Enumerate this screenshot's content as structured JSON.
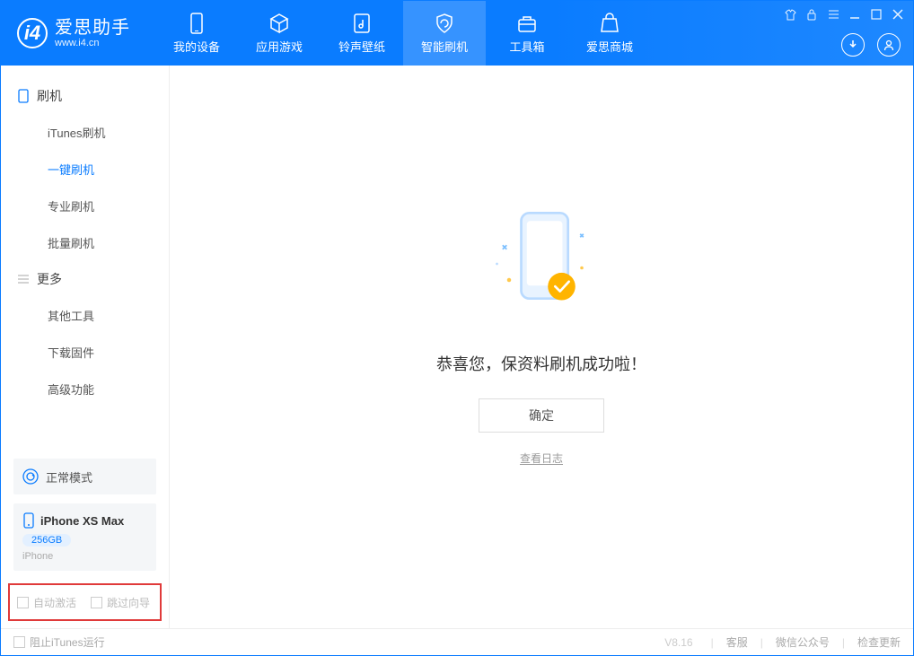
{
  "app": {
    "title": "爱思助手",
    "url": "www.i4.cn"
  },
  "nav": {
    "tabs": [
      {
        "label": "我的设备"
      },
      {
        "label": "应用游戏"
      },
      {
        "label": "铃声壁纸"
      },
      {
        "label": "智能刷机"
      },
      {
        "label": "工具箱"
      },
      {
        "label": "爱思商城"
      }
    ]
  },
  "sidebar": {
    "group1_title": "刷机",
    "group1_items": [
      "iTunes刷机",
      "一键刷机",
      "专业刷机",
      "批量刷机"
    ],
    "group2_title": "更多",
    "group2_items": [
      "其他工具",
      "下载固件",
      "高级功能"
    ]
  },
  "mode": {
    "label": "正常模式"
  },
  "device": {
    "name": "iPhone XS Max",
    "storage": "256GB",
    "type": "iPhone"
  },
  "options": {
    "auto_activate": "自动激活",
    "skip_guide": "跳过向导"
  },
  "main": {
    "success_title": "恭喜您，保资料刷机成功啦！",
    "confirm": "确定",
    "view_log": "查看日志"
  },
  "footer": {
    "block_itunes": "阻止iTunes运行",
    "version": "V8.16",
    "support": "客服",
    "wechat": "微信公众号",
    "check_update": "检查更新"
  }
}
